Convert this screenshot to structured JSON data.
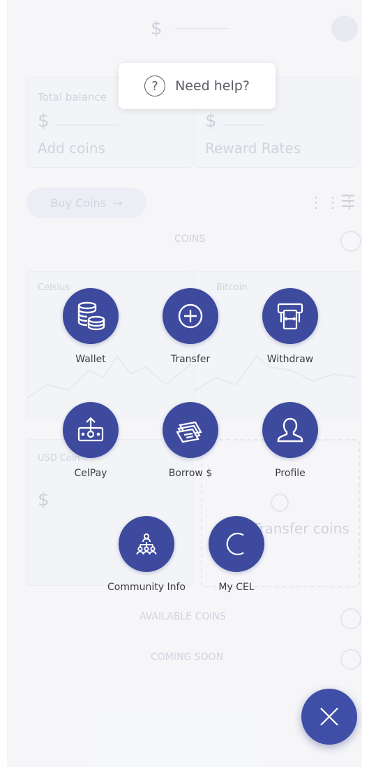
{
  "help": {
    "label": "Need help?"
  },
  "background": {
    "total_balance": "Total balance",
    "add_coins": "Add coins",
    "reward_rates": "Reward Rates",
    "buy_coins": "Buy Coins",
    "coins_section": "COINS",
    "available_coins": "AVAILABLE COINS",
    "coming_soon": "COMING SOON",
    "transfer_coins": "Transfer coins",
    "coin_a": "Celsius",
    "coin_b": "Bitcoin",
    "coin_c": "USD Coin"
  },
  "menu": {
    "wallet": "Wallet",
    "transfer": "Transfer",
    "withdraw": "Withdraw",
    "celpay": "CelPay",
    "borrow": "Borrow $",
    "profile": "Profile",
    "community": "Community Info",
    "mycel": "My CEL"
  },
  "colors": {
    "accent": "#3d4a9e",
    "fab": "#3f4ea6"
  },
  "icons": {
    "help": "question-circle-icon",
    "wallet": "coin-stack-icon",
    "transfer": "plus-circle-icon",
    "withdraw": "atm-cash-icon",
    "celpay": "banknote-upload-icon",
    "borrow": "cash-stack-icon",
    "profile": "user-silhouette-icon",
    "community": "community-network-icon",
    "mycel": "cel-logo-icon",
    "close": "close-x-icon"
  }
}
